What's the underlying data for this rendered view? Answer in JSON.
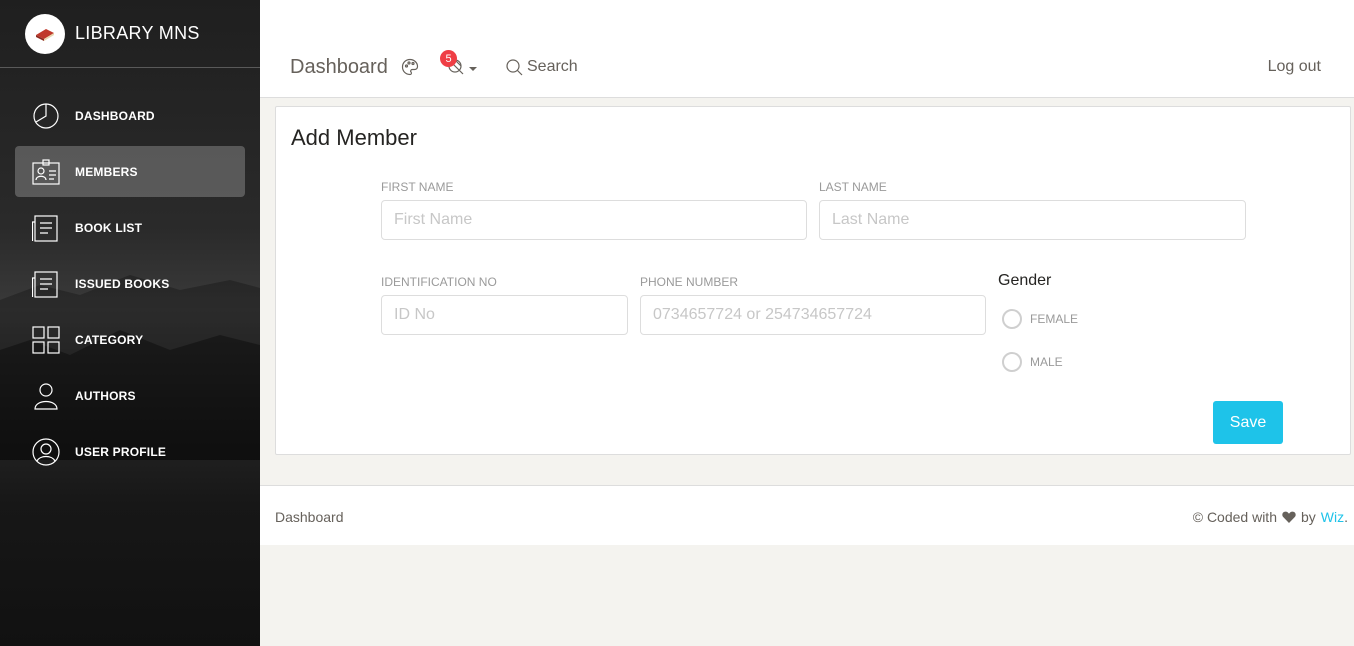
{
  "sidebar": {
    "app_title": "LIBRARY MNS",
    "logo_icon": "book-icon",
    "items": [
      {
        "label": "DASHBOARD",
        "icon": "pie-chart-icon",
        "active": false
      },
      {
        "label": "MEMBERS",
        "icon": "id-card-icon",
        "active": true
      },
      {
        "label": "BOOK LIST",
        "icon": "document-list-icon",
        "active": false
      },
      {
        "label": "ISSUED BOOKS",
        "icon": "document-list-icon",
        "active": false
      },
      {
        "label": "CATEGORY",
        "icon": "grid-icon",
        "active": false
      },
      {
        "label": "AUTHORS",
        "icon": "user-icon",
        "active": false
      },
      {
        "label": "USER PROFILE",
        "icon": "user-circle-icon",
        "active": false
      }
    ]
  },
  "topbar": {
    "brand": "Dashboard",
    "notification_count": "5",
    "search_label": "Search",
    "logout_label": "Log out"
  },
  "form": {
    "title": "Add Member",
    "first_name": {
      "label": "FIRST NAME",
      "placeholder": "First Name",
      "value": ""
    },
    "last_name": {
      "label": "LAST NAME",
      "placeholder": "Last Name",
      "value": ""
    },
    "id_no": {
      "label": "IDENTIFICATION NO",
      "placeholder": "ID No",
      "value": ""
    },
    "phone": {
      "label": "PHONE NUMBER",
      "placeholder": "0734657724 or 254734657724",
      "value": ""
    },
    "gender": {
      "title": "Gender",
      "options": [
        {
          "label": "FEMALE",
          "selected": false
        },
        {
          "label": "MALE",
          "selected": false
        }
      ]
    },
    "save_label": "Save"
  },
  "footer": {
    "left": "Dashboard",
    "right_prefix": "© Coded with",
    "right_by": "by",
    "author": "Wiz",
    "suffix": "."
  },
  "colors": {
    "accent": "#1ec3e9",
    "badge": "#ef3e45",
    "sidebar_bg": "#1f1f1f"
  }
}
